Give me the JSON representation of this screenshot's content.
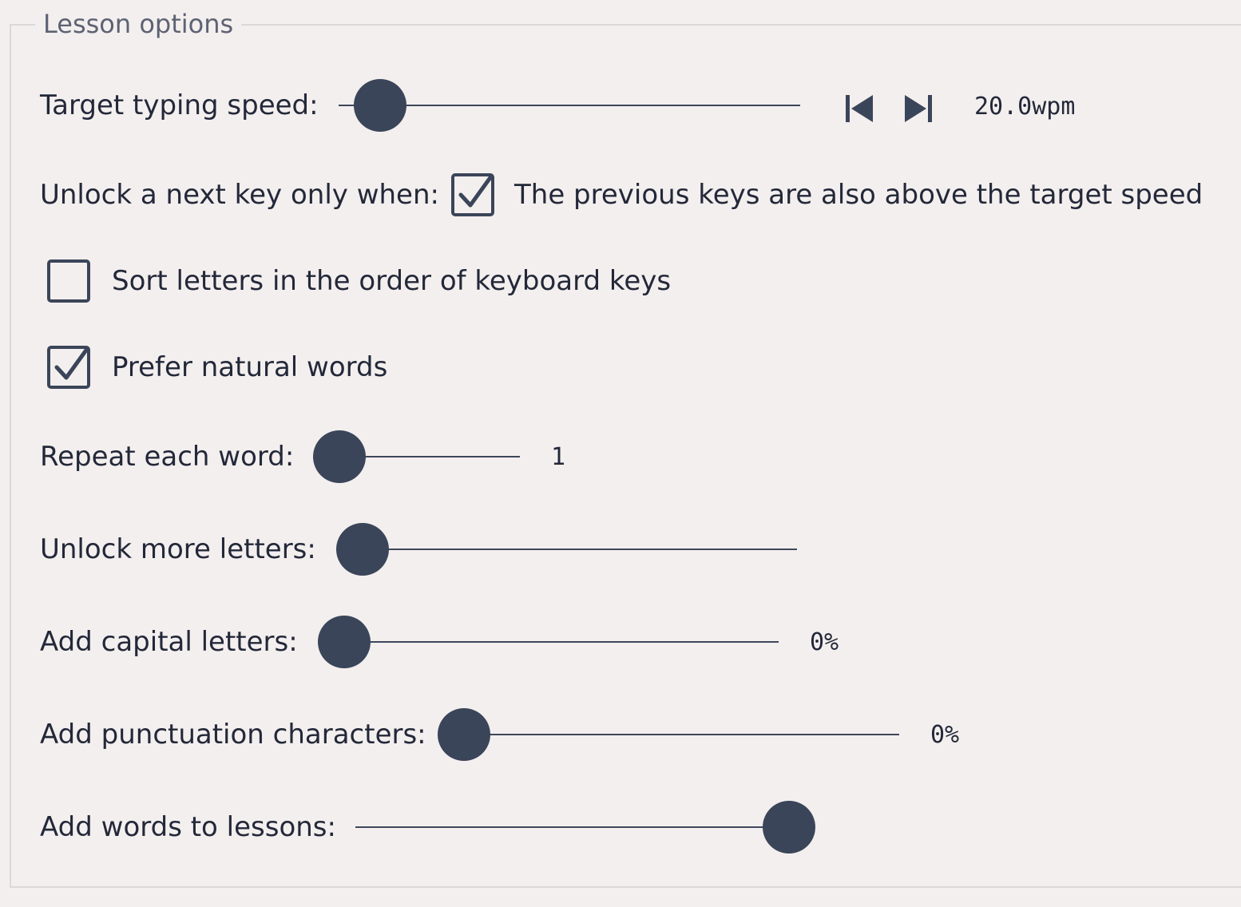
{
  "legend": "Lesson options",
  "target_speed": {
    "label": "Target typing speed:",
    "value": "20.0wpm",
    "level": 0.09,
    "first_icon": "skip-to-start-icon",
    "last_icon": "skip-to-end-icon"
  },
  "unlock_next_key": {
    "label": "Unlock a next key only when:",
    "checkbox_label": "The previous keys are also above the target speed",
    "checked": true
  },
  "sort_letters": {
    "label": "Sort letters in the order of keyboard keys",
    "checked": false
  },
  "natural_words": {
    "label": "Prefer natural words",
    "checked": true
  },
  "repeat_words": {
    "label": "Repeat each word:",
    "value": "1",
    "level": 0.0
  },
  "unlock_more_letters": {
    "label": "Unlock more letters:",
    "level": 0.0
  },
  "capital_letters": {
    "label": "Add capital letters:",
    "value": "0%",
    "level": 0.0
  },
  "punctuation": {
    "label": "Add punctuation characters:",
    "value": "0%",
    "level": 0.0
  },
  "words_to_lessons": {
    "label": "Add words to lessons:",
    "level": 1.0
  },
  "colors": {
    "background": "#f3efee",
    "text": "#232839",
    "control": "#3b4559",
    "border": "#dcd8d7"
  }
}
